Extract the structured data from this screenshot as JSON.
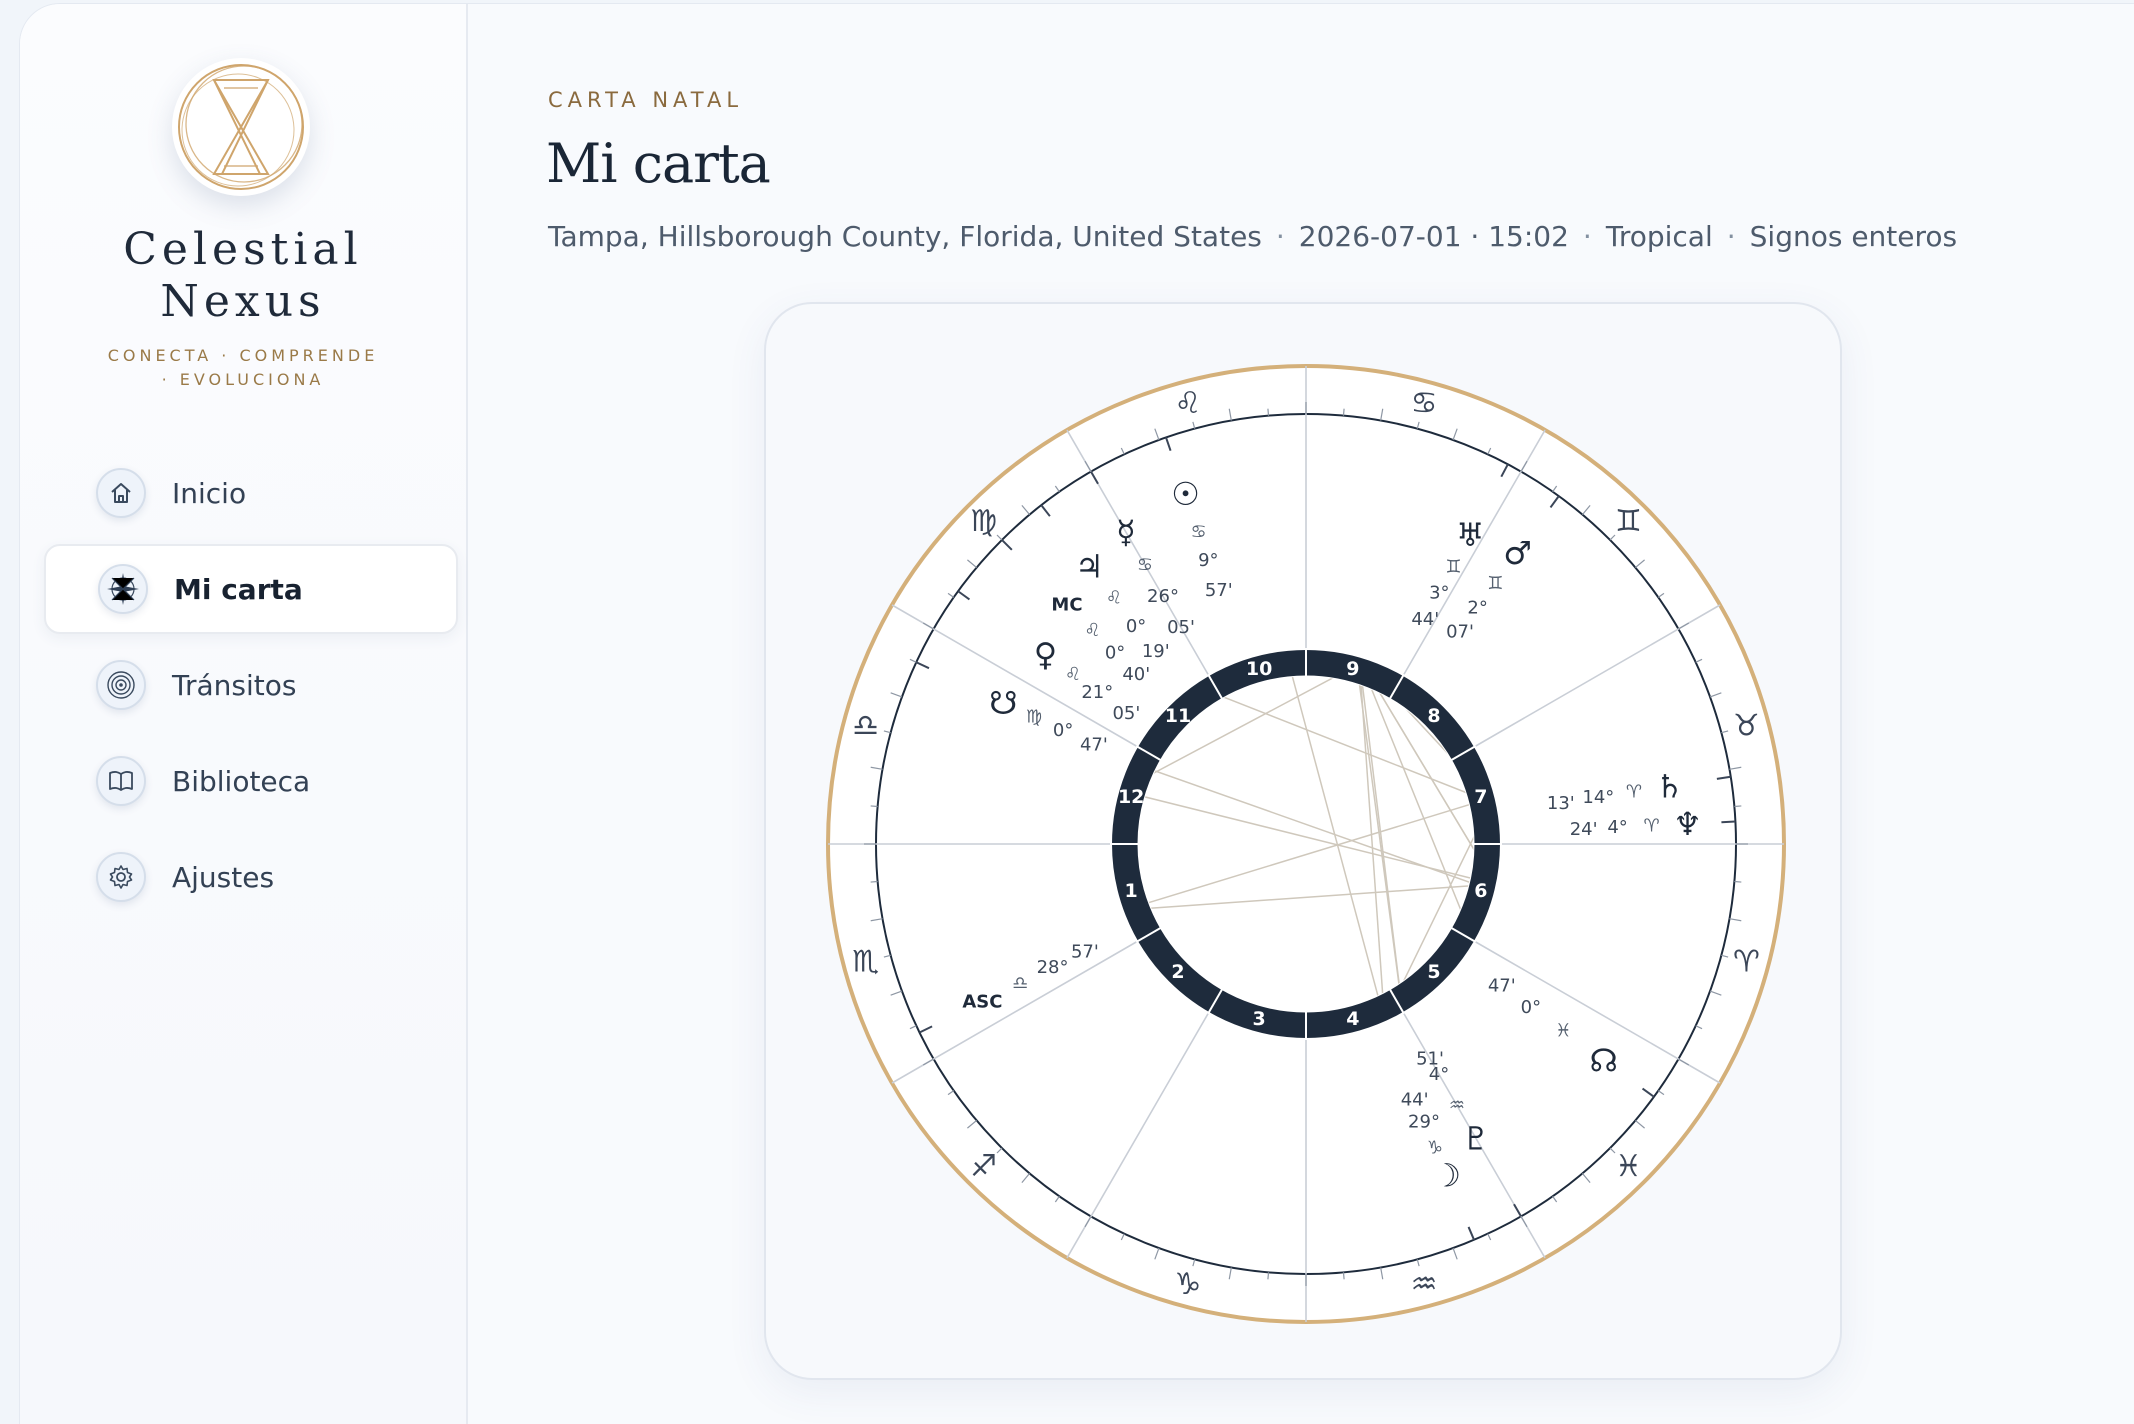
{
  "brand": {
    "name_line1": "Celestial",
    "name_line2": "Nexus",
    "tagline": "CONECTA · COMPRENDE · EVOLUCIONA"
  },
  "sidebar": {
    "items": [
      {
        "label": "Inicio",
        "icon": "home-icon",
        "active": false
      },
      {
        "label": "Mi carta",
        "icon": "compass-rose-icon",
        "active": true
      },
      {
        "label": "Tránsitos",
        "icon": "concentric-circles-icon",
        "active": false
      },
      {
        "label": "Biblioteca",
        "icon": "book-icon",
        "active": false
      },
      {
        "label": "Ajustes",
        "icon": "gear-icon",
        "active": false
      }
    ]
  },
  "header": {
    "eyebrow": "CARTA NATAL",
    "title": "Mi carta",
    "location": "Tampa, Hillsborough County, Florida, United States",
    "datetime": "2026-07-01 · 15:02",
    "zodiac": "Tropical",
    "house_system": "Signos enteros",
    "separator": "·"
  },
  "chart": {
    "colors": {
      "gold": "#d4b07a",
      "navy": "#1e2b3c",
      "line": "#9aa3ad",
      "aspect": "#cfc8bc"
    },
    "signs": [
      {
        "name": "Cancer",
        "glyph": "♋"
      },
      {
        "name": "Gemini",
        "glyph": "♊"
      },
      {
        "name": "Taurus",
        "glyph": "♉"
      },
      {
        "name": "Aries",
        "glyph": "♈"
      },
      {
        "name": "Pisces",
        "glyph": "♓"
      },
      {
        "name": "Aquarius",
        "glyph": "♒"
      },
      {
        "name": "Capricorn",
        "glyph": "♑"
      },
      {
        "name": "Sagittarius",
        "glyph": "♐"
      },
      {
        "name": "Scorpio",
        "glyph": "♏"
      },
      {
        "name": "Libra",
        "glyph": "♎"
      },
      {
        "name": "Virgo",
        "glyph": "♍"
      },
      {
        "name": "Leo",
        "glyph": "♌"
      }
    ],
    "houses": [
      "10",
      "9",
      "8",
      "7",
      "6",
      "5",
      "4",
      "3",
      "2",
      "1",
      "12",
      "11"
    ],
    "points": [
      {
        "name": "Sun",
        "glyph": "☉",
        "sign_glyph": "♋",
        "deg": "9°",
        "min": "57'"
      },
      {
        "name": "Mercury",
        "glyph": "☿",
        "sign_glyph": "♋",
        "deg": "26°",
        "min": "05'"
      },
      {
        "name": "Jupiter",
        "glyph": "♃",
        "sign_glyph": "♌",
        "deg": "0°",
        "min": "19'"
      },
      {
        "name": "MC",
        "glyph": "MC",
        "sign_glyph": "♌",
        "deg": "0°",
        "min": "40'"
      },
      {
        "name": "Venus",
        "glyph": "♀",
        "sign_glyph": "♌",
        "deg": "21°",
        "min": "05'"
      },
      {
        "name": "South Node",
        "glyph": "☋",
        "sign_glyph": "♍",
        "deg": "0°",
        "min": "47'"
      },
      {
        "name": "Uranus",
        "glyph": "♅",
        "sign_glyph": "♊",
        "deg": "3°",
        "min": "44'"
      },
      {
        "name": "Mars",
        "glyph": "♂",
        "sign_glyph": "♊",
        "deg": "2°",
        "min": "07'"
      },
      {
        "name": "Saturn",
        "glyph": "♄",
        "sign_glyph": "♈",
        "deg": "14°",
        "min": "13'"
      },
      {
        "name": "Neptune",
        "glyph": "♆",
        "sign_glyph": "♈",
        "deg": "4°",
        "min": "24'"
      },
      {
        "name": "North Node",
        "glyph": "☊",
        "sign_glyph": "♓",
        "deg": "0°",
        "min": "47'"
      },
      {
        "name": "Pluto",
        "glyph": "♇",
        "sign_glyph": "♒",
        "deg": "4°",
        "min": "51'"
      },
      {
        "name": "Moon",
        "glyph": "☽",
        "sign_glyph": "♑",
        "deg": "29°",
        "min": "44'"
      },
      {
        "name": "ASC",
        "glyph": "ASC",
        "sign_glyph": "♎",
        "deg": "28°",
        "min": "57'"
      }
    ]
  }
}
